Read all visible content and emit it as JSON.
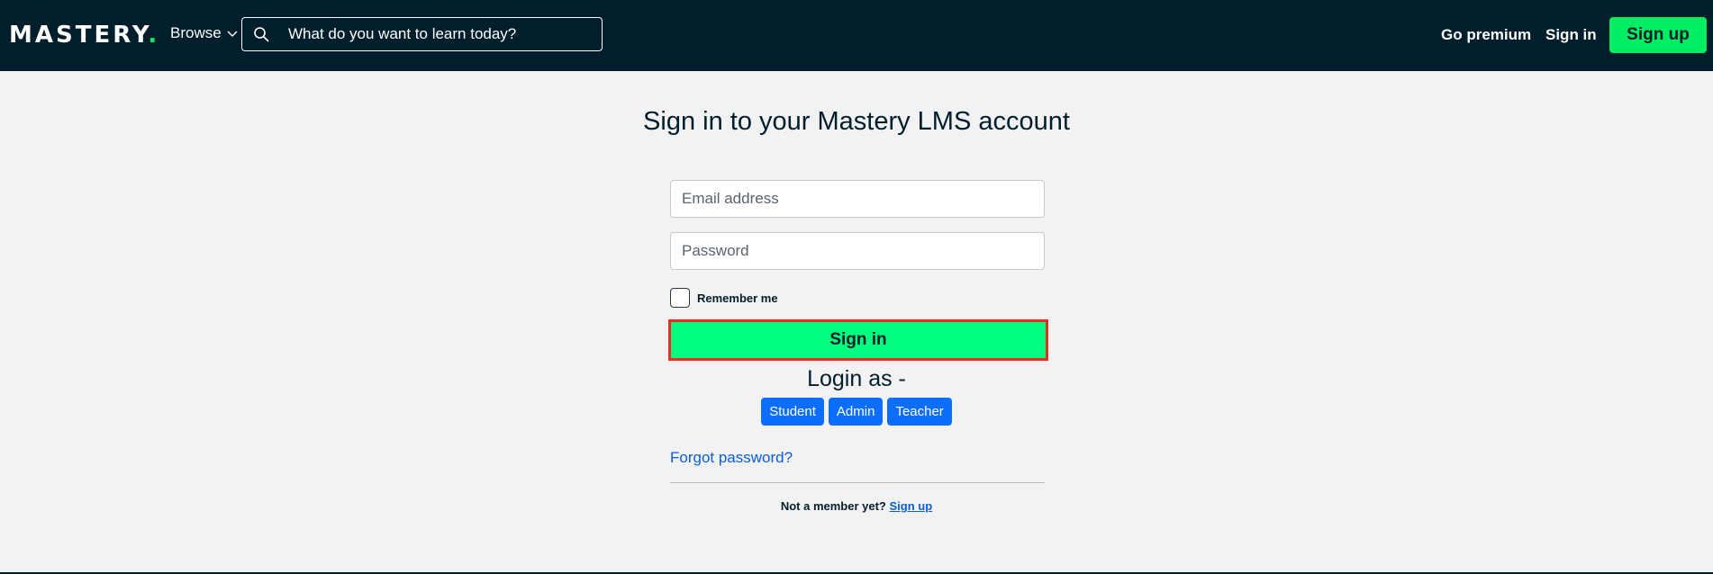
{
  "header": {
    "logo_text": "MASTERY",
    "logo_dot": ".",
    "browse_label": "Browse",
    "search_placeholder": "What do you want to learn today?",
    "go_premium_label": "Go premium",
    "sign_in_label": "Sign in",
    "sign_up_label": "Sign up"
  },
  "form": {
    "title": "Sign in to your Mastery LMS account",
    "email_placeholder": "Email address",
    "password_placeholder": "Password",
    "remember_label": "Remember me",
    "submit_label": "Sign in",
    "login_as_label": "Login as -",
    "roles": [
      "Student",
      "Admin",
      "Teacher"
    ],
    "forgot_label": "Forgot password?",
    "member_prompt": "Not a member yet?",
    "member_link": "Sign up"
  },
  "colors": {
    "header_bg": "#001e2b",
    "accent_green": "#00ed64",
    "signin_button": "#00ff7f",
    "highlight_border": "#ef2b1e",
    "role_button": "#0d6efd",
    "link": "#0b5ed7"
  },
  "icons": {
    "search": "search-icon",
    "browse": "chevron-down-icon"
  }
}
